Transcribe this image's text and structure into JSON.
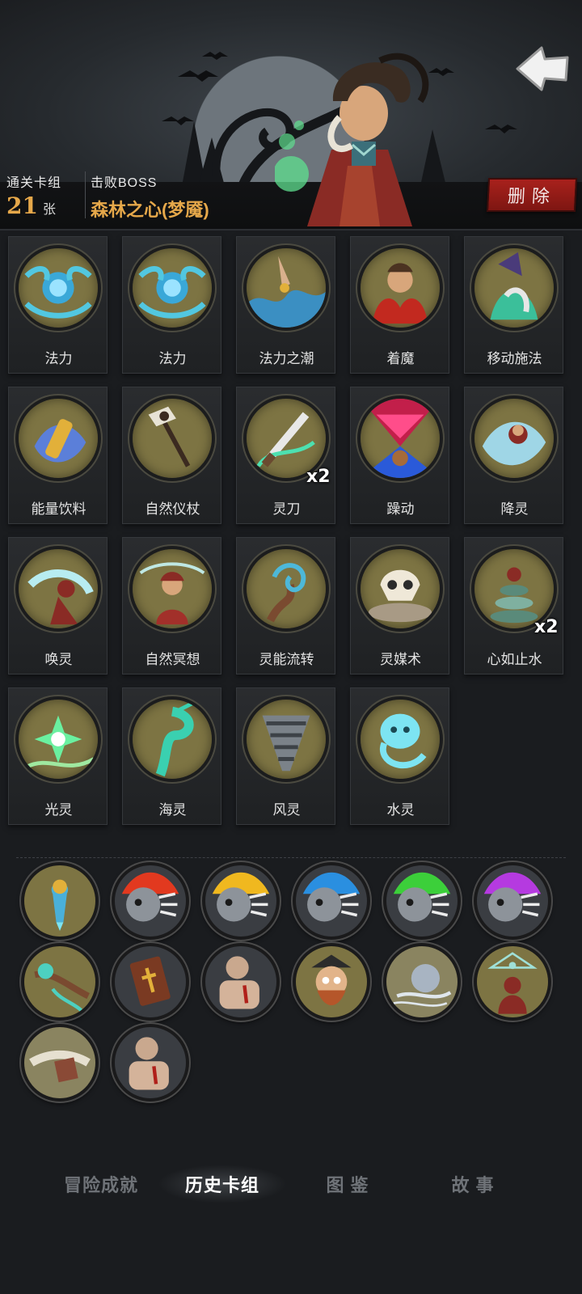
{
  "header": {
    "deck_label": "通关卡组",
    "deck_count": "21",
    "deck_unit": "张",
    "boss_label": "击败BOSS",
    "boss_name": "森林之心(梦魇)",
    "delete_label": "删除"
  },
  "cards": [
    {
      "name": "法力",
      "qty": ""
    },
    {
      "name": "法力",
      "qty": ""
    },
    {
      "name": "法力之潮",
      "qty": ""
    },
    {
      "name": "着魔",
      "qty": ""
    },
    {
      "name": "移动施法",
      "qty": ""
    },
    {
      "name": "能量饮料",
      "qty": ""
    },
    {
      "name": "自然仪杖",
      "qty": ""
    },
    {
      "name": "灵刀",
      "qty": "x2"
    },
    {
      "name": "躁动",
      "qty": ""
    },
    {
      "name": "降灵",
      "qty": ""
    },
    {
      "name": "唤灵",
      "qty": ""
    },
    {
      "name": "自然冥想",
      "qty": ""
    },
    {
      "name": "灵能流转",
      "qty": ""
    },
    {
      "name": "灵媒术",
      "qty": ""
    },
    {
      "name": "心如止水",
      "qty": "x2"
    },
    {
      "name": "光灵",
      "qty": ""
    },
    {
      "name": "海灵",
      "qty": ""
    },
    {
      "name": "风灵",
      "qty": ""
    },
    {
      "name": "水灵",
      "qty": ""
    }
  ],
  "relic_icons": [
    "spirit-vase-icon",
    "red-flame-skull-icon",
    "yellow-flame-skull-icon",
    "blue-flame-skull-icon",
    "green-flame-skull-icon",
    "purple-flame-skull-icon",
    "spirit-branch-icon",
    "holy-book-icon",
    "brute-fist-icon",
    "pirate-captain-icon",
    "wind-stone-icon",
    "all-seeing-eye-icon",
    "tattered-scroll-icon",
    "brute-fist-icon"
  ],
  "tabs": [
    {
      "label": "冒险成就",
      "active": false
    },
    {
      "label": "历史卡组",
      "active": true
    },
    {
      "label": "图 鉴",
      "active": false
    },
    {
      "label": "故 事",
      "active": false
    }
  ],
  "colors": {
    "gold": "#e6a84a",
    "delete_red": "#a8211c",
    "card_art_bg": "#7d7443"
  }
}
